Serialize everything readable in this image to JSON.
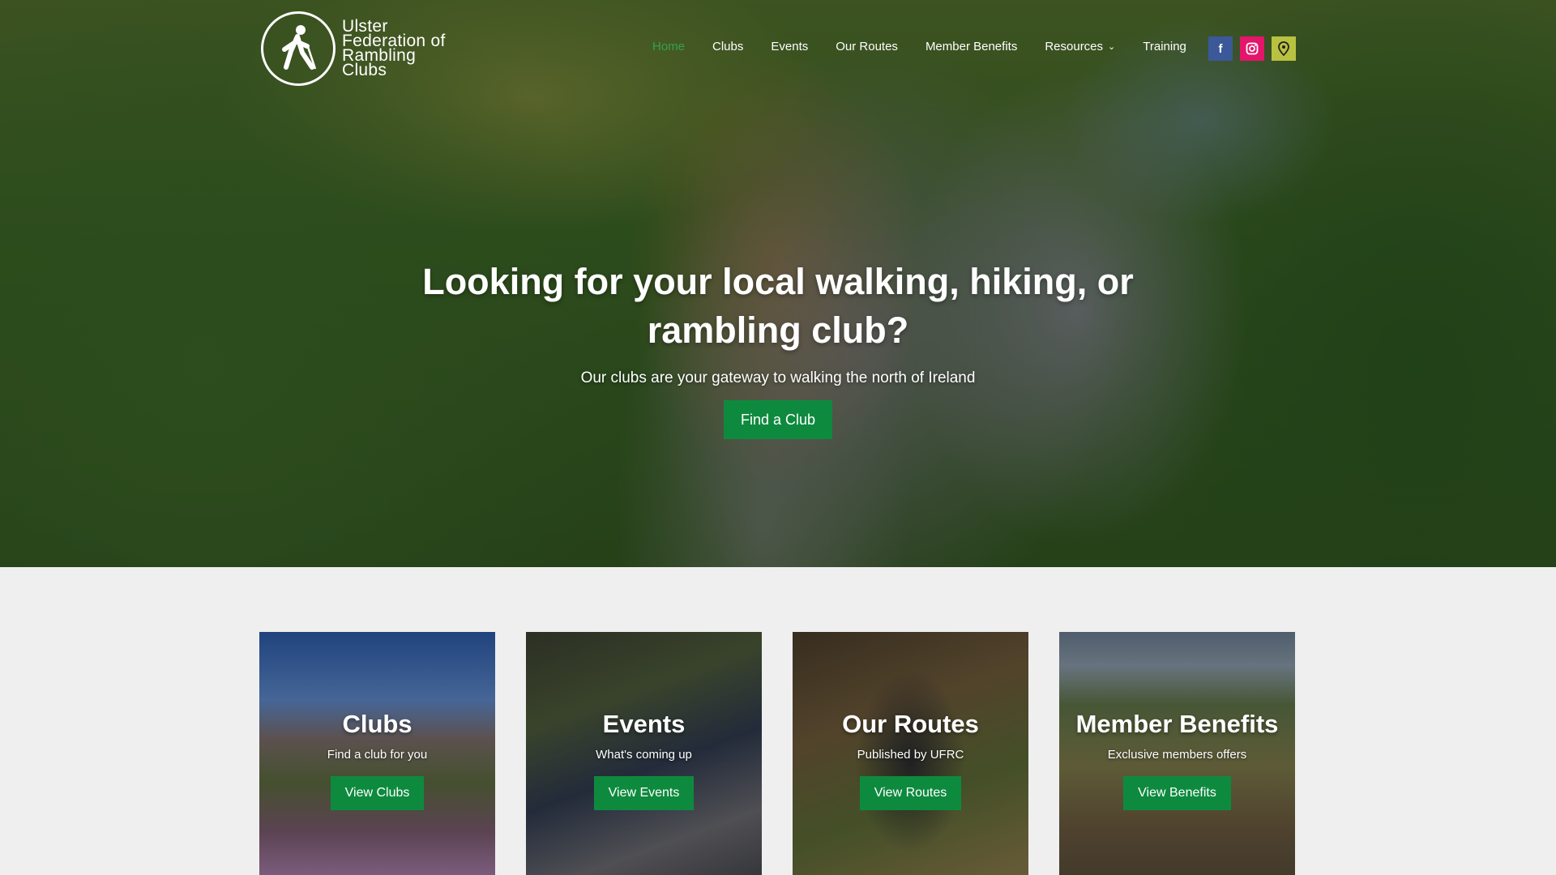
{
  "site": {
    "logo_lines": [
      "Ulster",
      "Federation of",
      "Rambling",
      "Clubs"
    ]
  },
  "nav": {
    "items": [
      {
        "label": "Home",
        "active": true
      },
      {
        "label": "Clubs",
        "active": false
      },
      {
        "label": "Events",
        "active": false
      },
      {
        "label": "Our Routes",
        "active": false
      },
      {
        "label": "Member Benefits",
        "active": false
      },
      {
        "label": "Resources",
        "active": false,
        "has_dropdown": true
      },
      {
        "label": "Training",
        "active": false
      }
    ],
    "social": [
      {
        "icon": "facebook-icon",
        "glyph": "f",
        "color": "#3b5998"
      },
      {
        "icon": "instagram-icon",
        "glyph": "◎",
        "color": "#e4156b"
      },
      {
        "icon": "map-pin-icon",
        "glyph": "⚲",
        "color": "#b9c140"
      }
    ]
  },
  "hero": {
    "title": "Looking for your local walking, hiking, or rambling club?",
    "subtitle": "Our clubs are your gateway to walking the north of Ireland",
    "button_label": "Find a Club"
  },
  "cards": [
    {
      "title": "Clubs",
      "subtitle": "Find a club for you",
      "button_label": "View Clubs"
    },
    {
      "title": "Events",
      "subtitle": "What's coming up",
      "button_label": "View Events"
    },
    {
      "title": "Our Routes",
      "subtitle": "Published by UFRC",
      "button_label": "View Routes"
    },
    {
      "title": "Member Benefits",
      "subtitle": "Exclusive members offers",
      "button_label": "View Benefits"
    }
  ],
  "colors": {
    "accent_green": "#0e8a3e",
    "active_nav": "#2fa350"
  }
}
